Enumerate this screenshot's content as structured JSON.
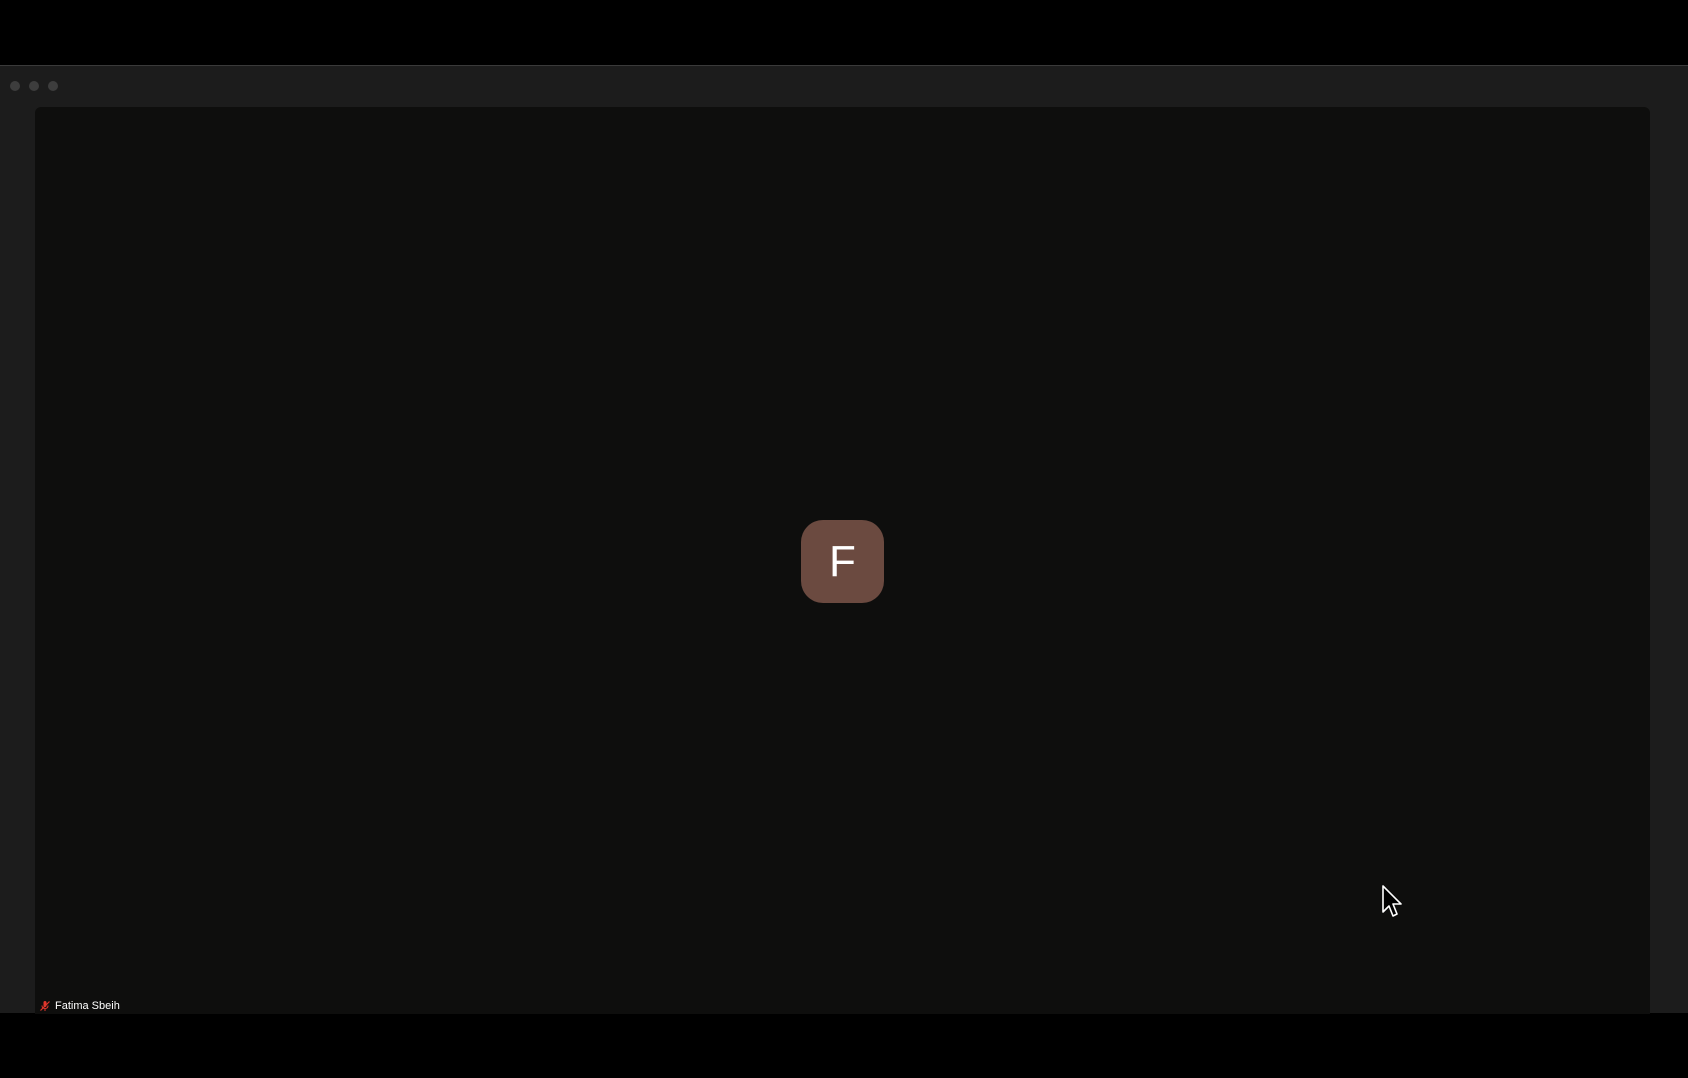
{
  "participant": {
    "name": "Fatima Sbeih",
    "initial": "F",
    "avatar_color": "#6b4a40",
    "mic_status": "muted",
    "mic_icon": "mic-muted-icon",
    "mic_icon_color": "#e0362c"
  },
  "window": {
    "controls": [
      "close-button",
      "minimize-button",
      "zoom-button"
    ]
  }
}
